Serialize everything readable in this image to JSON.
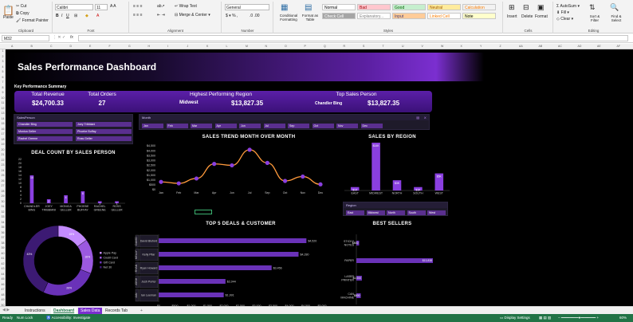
{
  "ribbon": {
    "clipboard": {
      "paste": "Paste",
      "cut": "Cut",
      "copy": "Copy",
      "format_painter": "Format Painter",
      "label": "Clipboard"
    },
    "font": {
      "name": "Calibri",
      "size": "11",
      "label": "Font",
      "bold": "B",
      "italic": "I",
      "underline": "U"
    },
    "alignment": {
      "wrap": "Wrap Text",
      "merge": "Merge & Center",
      "label": "Alignment"
    },
    "number": {
      "format": "General",
      "label": "Number"
    },
    "styles": {
      "conditional": "Conditional Formatting",
      "format_table": "Format as Table",
      "label": "Styles",
      "cells": [
        {
          "text": "Normal",
          "bg": "#ffffff",
          "fg": "#000000"
        },
        {
          "text": "Bad",
          "bg": "#ffc7ce",
          "fg": "#9c0006"
        },
        {
          "text": "Good",
          "bg": "#c6efce",
          "fg": "#006100"
        },
        {
          "text": "Neutral",
          "bg": "#ffeb9c",
          "fg": "#9c5700"
        },
        {
          "text": "Calculation",
          "bg": "#f2f2f2",
          "fg": "#fa7d00"
        },
        {
          "text": "Check Cell",
          "bg": "#a5a5a5",
          "fg": "#ffffff"
        },
        {
          "text": "Explanatory...",
          "bg": "#ffffff",
          "fg": "#7f7f7f"
        },
        {
          "text": "Input",
          "bg": "#ffcc99",
          "fg": "#3f3f76"
        },
        {
          "text": "Linked Cell",
          "bg": "#ffffff",
          "fg": "#fa7d00"
        },
        {
          "text": "Note",
          "bg": "#ffffcc",
          "fg": "#000000"
        }
      ]
    },
    "cells": {
      "insert": "Insert",
      "delete": "Delete",
      "format": "Format",
      "label": "Cells"
    },
    "editing": {
      "autosum": "AutoSum",
      "fill": "Fill",
      "clear": "Clear",
      "sort": "Sort & Filter",
      "find": "Find & Select",
      "label": "Editing"
    }
  },
  "formula_bar": {
    "name_box": "M32",
    "fx": "fx",
    "content": ""
  },
  "columns": [
    "A",
    "B",
    "C",
    "D",
    "E",
    "F",
    "G",
    "H",
    "I",
    "J",
    "K",
    "L",
    "M",
    "N",
    "O",
    "P",
    "Q",
    "R",
    "S",
    "T",
    "U",
    "V",
    "W",
    "X",
    "Y",
    "Z",
    "AA",
    "AB",
    "AC",
    "AD",
    "AE",
    "AF"
  ],
  "dashboard": {
    "title": "Sales Performance Dashboard",
    "kpi_section": "Key Performance Summary",
    "kpis": {
      "total_revenue": {
        "label": "Total Revenue",
        "value": "$24,700.33"
      },
      "total_orders": {
        "label": "Total Orders",
        "value": "27"
      },
      "highest_region": {
        "label": "Highest Performing Region",
        "name": "Midwest",
        "value": "$13,827.35"
      },
      "top_sales": {
        "label": "Top Sales Person",
        "name": "Chandler Bing",
        "value": "$13,827.35"
      }
    },
    "salesperson_slicer": {
      "title": "SalesPerson",
      "items": [
        "Chandler Bing",
        "Joey Tribbiani",
        "Monica Geller",
        "Phoebe Buffay",
        "Rachel Greene",
        "Ross Geller"
      ]
    },
    "month_slicer": {
      "title": "Month",
      "items": [
        "Jan",
        "Feb",
        "Mar",
        "Apr",
        "Jun",
        "Jul",
        "Sep",
        "Oct",
        "Nov",
        "Dec"
      ]
    },
    "region_slicer": {
      "title": "Region",
      "items": [
        "East",
        "Midwest",
        "North",
        "South",
        "West"
      ]
    }
  },
  "chart_data": [
    {
      "type": "bar",
      "title": "DEAL COUNT BY SALES PERSON",
      "categories": [
        "CHANDLER BING",
        "JOEY TRIBBIANI",
        "MONICA GELLER",
        "PHOEBE BUFFAY",
        "RACHEL GREENE",
        "ROSS GELLER"
      ],
      "values": [
        14,
        2,
        4,
        6,
        1,
        1
      ],
      "ylim": [
        0,
        22
      ],
      "yticks": [
        0,
        2,
        4,
        6,
        8,
        10,
        12,
        14,
        16,
        18,
        20,
        22
      ]
    },
    {
      "type": "line",
      "title": "SALES TREND MONTH OVER MONTH",
      "categories": [
        "Jan",
        "Feb",
        "Mar",
        "Apr",
        "Jun",
        "Jul",
        "Sep",
        "Oct",
        "Nov",
        "Dec"
      ],
      "values": [
        800,
        650,
        1150,
        2650,
        2500,
        4100,
        2750,
        900,
        1350,
        550
      ],
      "ylim": [
        0,
        4500
      ],
      "yticks": [
        "$0",
        "$500",
        "$1,000",
        "$1,500",
        "$2,000",
        "$2,500",
        "$3,000",
        "$3,500",
        "$4,000",
        "$4,500"
      ]
    },
    {
      "type": "bar",
      "title": "SALES BY REGION",
      "categories": [
        "EAST",
        "MIDWEST",
        "NORTH",
        "SOUTH",
        "WEST"
      ],
      "values": [
        1,
        14,
        3,
        1,
        5
      ],
      "labels": [
        "$1K",
        "$14K",
        "$3K",
        "$1K",
        "$5K"
      ]
    },
    {
      "type": "pie",
      "legend": [
        "Apple Pay",
        "Credit Card",
        "Gift Card",
        "Net 30"
      ],
      "labels": [
        "15%",
        "16%",
        "26%",
        "43%"
      ],
      "values": [
        15,
        16,
        26,
        43
      ],
      "colors": [
        "#c48bff",
        "#9b59e0",
        "#6a32b8",
        "#3c1a73"
      ]
    },
    {
      "type": "bar",
      "title": "TOP 5 DEALS & CUSTOMER",
      "categories": [
        "David Bluford",
        "Kelly Pilar",
        "Ryan Howard",
        "Josh Porter",
        "Ian Leeman"
      ],
      "group_labels": [
        "DAVID",
        "KELLY",
        "RYAN",
        "JOSH",
        "IAN"
      ],
      "values": [
        4520,
        4280,
        3456,
        2044,
        1991
      ],
      "labels": [
        "$4,520",
        "$4,280",
        "$3,456",
        "$2,044",
        "$1,991"
      ],
      "xlim": [
        0,
        5000
      ],
      "xticks": [
        "$0",
        "$500",
        "$1,000",
        "$1,500",
        "$2,000",
        "$2,500",
        "$3,000",
        "$3,500",
        "$4,000",
        "$4,500",
        "$5,000"
      ]
    },
    {
      "type": "bar",
      "title": "BEST SELLERS",
      "categories": [
        "STICKY NOTES",
        "PAPER",
        "LASER PRINTER",
        "CAN MACHINE"
      ],
      "values": [
        500,
        13838,
        1000,
        800
      ],
      "labels": [
        "$500",
        "$13,838",
        "$1,000",
        "$800"
      ]
    }
  ],
  "sheets": {
    "tabs": [
      "Instructions",
      "Dashboard",
      "Sales Data",
      "Records Tab"
    ],
    "active": "Dashboard",
    "add": "+"
  },
  "status": {
    "ready": "Ready",
    "num_lock": "Num Lock",
    "accessibility": "Accessibility: Investigate",
    "display": "Display Settings",
    "zoom": "60%"
  },
  "colors": {
    "accent": "#7b2fd0",
    "accent_light": "#9b59e0",
    "line": "#ff9a3c",
    "excel_green": "#217346"
  }
}
